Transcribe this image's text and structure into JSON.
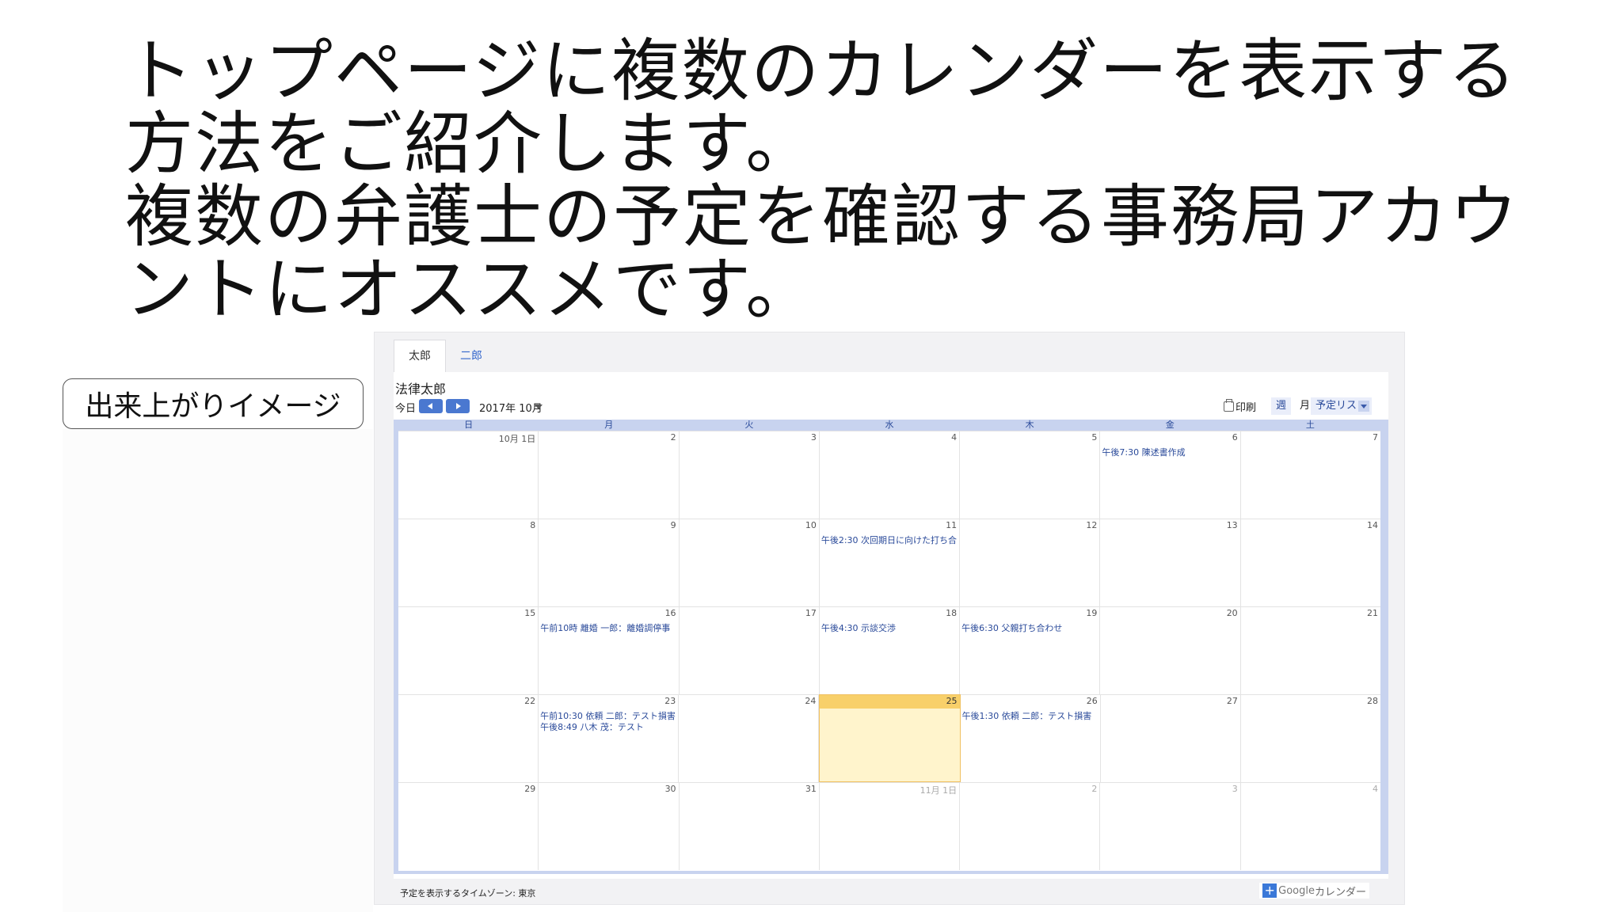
{
  "headline": {
    "line1": "トップページに複数のカレンダーを表示する",
    "line2": "方法をご紹介します。",
    "line3": "複数の弁護士の予定を確認する事務局アカウ",
    "line4": "ントにオススメです。"
  },
  "side_label": "出来上がりイメージ",
  "calendar": {
    "tabs": [
      {
        "label": "太郎"
      },
      {
        "label": "二郎"
      }
    ],
    "title": "法律太郎",
    "toolbar": {
      "today": "今日",
      "month_label": "2017年 10月",
      "print": "印刷",
      "week": "週",
      "month": "月",
      "agenda": "予定リスト"
    },
    "weekdays": [
      "日",
      "月",
      "火",
      "水",
      "木",
      "金",
      "土"
    ],
    "weeks": [
      [
        {
          "n": "10月 1日"
        },
        {
          "n": "2"
        },
        {
          "n": "3"
        },
        {
          "n": "4"
        },
        {
          "n": "5"
        },
        {
          "n": "6",
          "events": [
            "午後7:30 陳述書作成"
          ]
        },
        {
          "n": "7"
        }
      ],
      [
        {
          "n": "8"
        },
        {
          "n": "9"
        },
        {
          "n": "10"
        },
        {
          "n": "11",
          "events": [
            "午後2:30 次回期日に向けた打ち合"
          ]
        },
        {
          "n": "12"
        },
        {
          "n": "13"
        },
        {
          "n": "14"
        }
      ],
      [
        {
          "n": "15"
        },
        {
          "n": "16",
          "events": [
            "午前10時 離婚 一郎：離婚調停事"
          ]
        },
        {
          "n": "17"
        },
        {
          "n": "18",
          "events": [
            "午後4:30 示談交渉"
          ]
        },
        {
          "n": "19",
          "events": [
            "午後6:30 父親打ち合わせ"
          ]
        },
        {
          "n": "20"
        },
        {
          "n": "21"
        }
      ],
      [
        {
          "n": "22"
        },
        {
          "n": "23",
          "events": [
            "午前10:30 依頼 二郎：テスト損害",
            "午後8:49 八木 茂：テスト"
          ]
        },
        {
          "n": "24"
        },
        {
          "n": "25",
          "today": true
        },
        {
          "n": "26",
          "events": [
            "午後1:30 依頼 二郎：テスト損害"
          ]
        },
        {
          "n": "27"
        },
        {
          "n": "28"
        }
      ],
      [
        {
          "n": "29"
        },
        {
          "n": "30"
        },
        {
          "n": "31"
        },
        {
          "n": "11月 1日",
          "other": true
        },
        {
          "n": "2",
          "other": true
        },
        {
          "n": "3",
          "other": true
        },
        {
          "n": "4",
          "other": true
        }
      ]
    ],
    "footer": {
      "timezone": "予定を表示するタイムゾーン: 東京",
      "brand_google": "Google",
      "brand_suffix": "カレンダー"
    }
  }
}
